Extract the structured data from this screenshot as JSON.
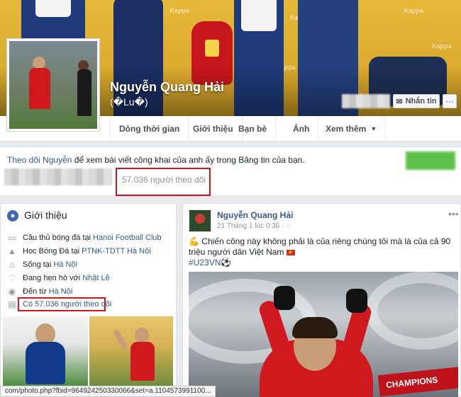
{
  "profile": {
    "name": "Nguyễn Quang Hải",
    "alias": "(�Lu�)"
  },
  "cover": {
    "brand_text": "Kappa",
    "message_button": "Nhắn tin",
    "more_button": "···"
  },
  "nav": {
    "timeline": "Dòng thời gian",
    "about": "Giới thiệu",
    "friends": "Bạn bè",
    "photos": "Ảnh",
    "more": "Xem thêm"
  },
  "follow": {
    "prefix": "Theo dõi",
    "name_link": "Nguyễn",
    "suffix": "để xem bài viết công khai của anh ấy trong Bảng tin của bạn.",
    "followers": "57.036 người theo dõi"
  },
  "intro": {
    "title": "Giới thiệu",
    "rows": [
      {
        "icon": "briefcase-icon",
        "text": "Cầu thủ bóng đá tại",
        "link": "Hanoi Football Club"
      },
      {
        "icon": "school-icon",
        "text": "Học Bóng Đá tại",
        "link": "PTNK-TDTT Hà Nội"
      },
      {
        "icon": "home-icon",
        "text": "Sống tại",
        "link": "Hà Nội"
      },
      {
        "icon": "heart-icon",
        "text": "Đang hẹn hò với",
        "link": "Nhật Lê"
      },
      {
        "icon": "location-icon",
        "text": "Đến từ",
        "link": "Hà Nội"
      },
      {
        "icon": "followers-icon",
        "text": "Có 57.036 người theo dõi",
        "link": ""
      }
    ]
  },
  "post": {
    "author": "Nguyễn Quang Hải",
    "time": "21 Tháng 1 lúc 0:36 ·",
    "text": "Chiến công này không phải là của riêng chúng tôi mà là của cả 90 triệu người dân Việt Nam",
    "hashtag": "#U23VN",
    "banner": "CHAMPIONS"
  },
  "status_url": "com/photo.php?fbid=964924250330066&set=a.1104573991100..."
}
